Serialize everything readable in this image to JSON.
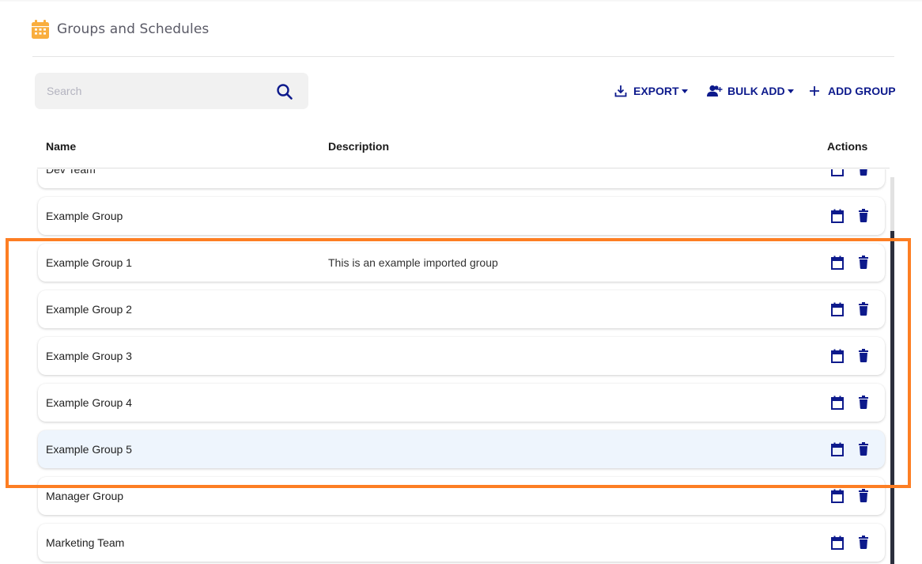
{
  "header": {
    "title": "Groups and Schedules",
    "icon": "calendar-icon",
    "icon_color": "#f9ae3e"
  },
  "search": {
    "placeholder": "Search",
    "value": "",
    "icon": "search-icon"
  },
  "toolbar": {
    "export_label": "EXPORT",
    "bulk_add_label": "BULK ADD",
    "add_group_label": "ADD GROUP",
    "accent_color": "#0d1a8c"
  },
  "table": {
    "columns": [
      "Name",
      "Description",
      "Actions"
    ],
    "rows": [
      {
        "name": "Dev Team",
        "description": ""
      },
      {
        "name": "Example Group",
        "description": ""
      },
      {
        "name": "Example Group 1",
        "description": "This is an example imported group"
      },
      {
        "name": "Example Group 2",
        "description": ""
      },
      {
        "name": "Example Group 3",
        "description": ""
      },
      {
        "name": "Example Group 4",
        "description": ""
      },
      {
        "name": "Example Group 5",
        "description": "",
        "hovered": true
      },
      {
        "name": "Manager Group",
        "description": ""
      },
      {
        "name": "Marketing Team",
        "description": ""
      }
    ],
    "row_actions": [
      "schedule-calendar-icon",
      "delete-trash-icon"
    ]
  },
  "annotation": {
    "highlight_color": "#fd7e23",
    "highlighted_rows": [
      "Example Group 1",
      "Example Group 2",
      "Example Group 3",
      "Example Group 4",
      "Example Group 5"
    ]
  }
}
